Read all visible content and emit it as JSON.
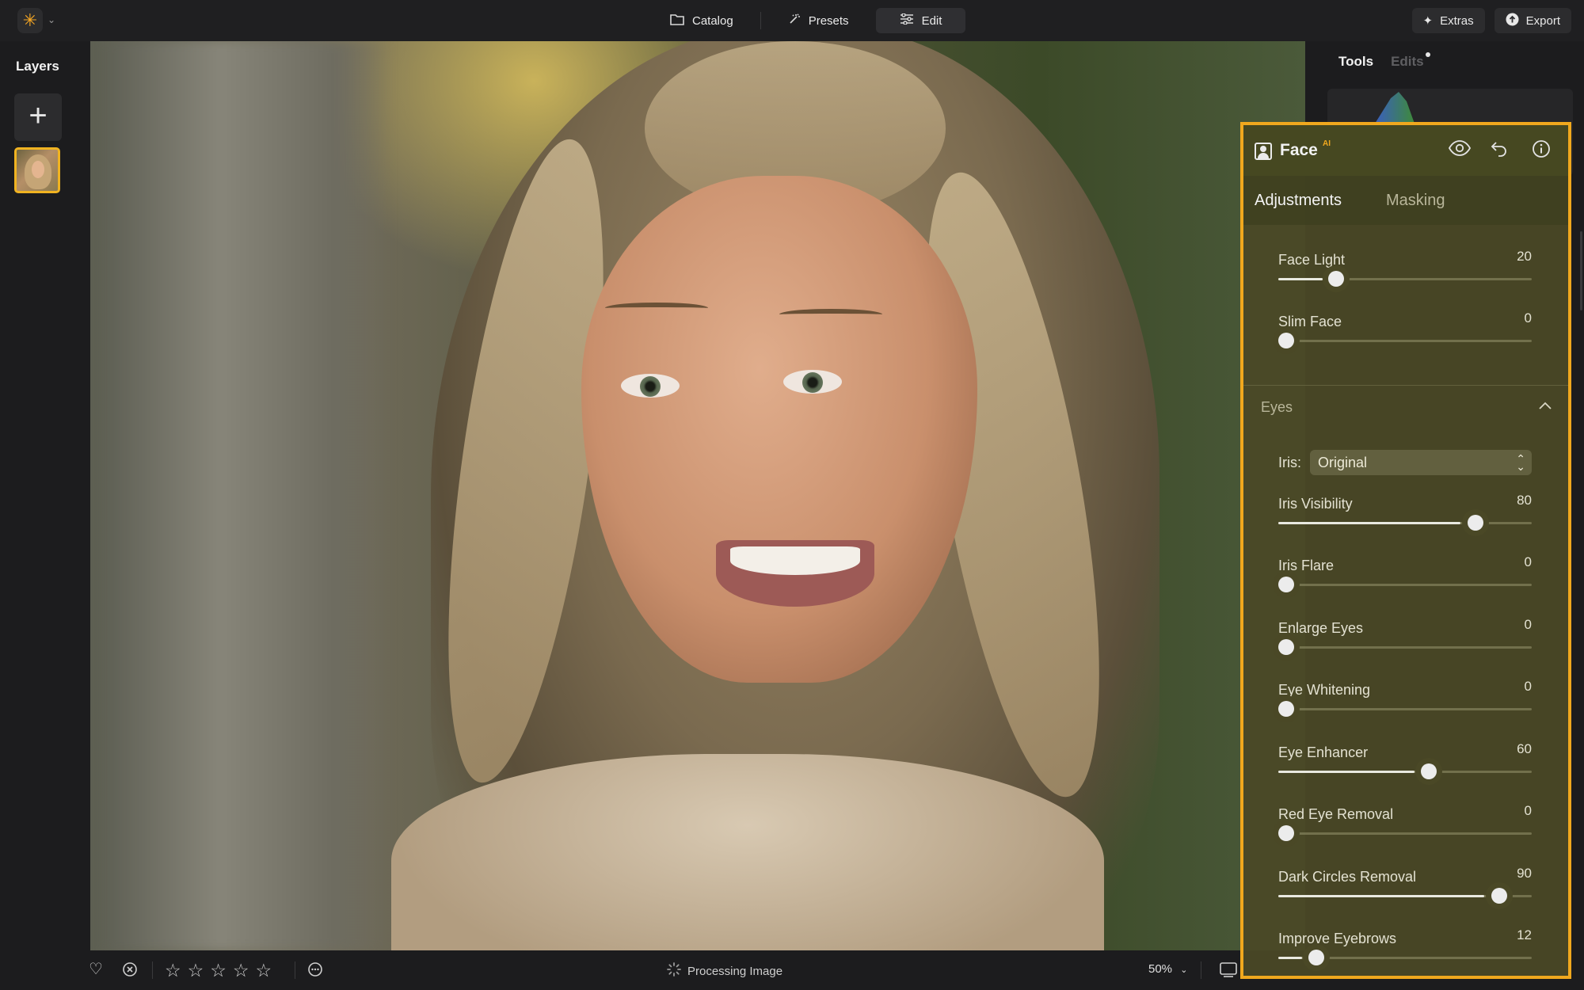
{
  "topbar": {
    "nav": [
      {
        "label": "Catalog",
        "icon": "folder-icon"
      },
      {
        "label": "Presets",
        "icon": "sparkle-wand-icon"
      },
      {
        "label": "Edit",
        "icon": "sliders-icon",
        "active": true
      }
    ],
    "extras_label": "Extras",
    "export_label": "Export"
  },
  "layers": {
    "title": "Layers"
  },
  "tools_panel": {
    "tab_tools": "Tools",
    "tab_edits": "Edits"
  },
  "face_panel": {
    "title": "Face",
    "ai_badge": "AI",
    "tab_adjustments": "Adjustments",
    "tab_masking": "Masking",
    "sliders_top": [
      {
        "label": "Face Light",
        "value": "20"
      },
      {
        "label": "Slim Face",
        "value": "0"
      }
    ],
    "eyes_section": "Eyes",
    "iris_label": "Iris:",
    "iris_value": "Original",
    "sliders_eyes": [
      {
        "label": "Iris Visibility",
        "value": "80"
      },
      {
        "label": "Iris Flare",
        "value": "0"
      },
      {
        "label": "Enlarge Eyes",
        "value": "0"
      },
      {
        "label": "Eye Whitening",
        "value": "0"
      },
      {
        "label": "Eye Enhancer",
        "value": "60"
      },
      {
        "label": "Red Eye Removal",
        "value": "0"
      },
      {
        "label": "Dark Circles Removal",
        "value": "90"
      },
      {
        "label": "Improve Eyebrows",
        "value": "12"
      }
    ]
  },
  "bottombar": {
    "status": "Processing Image",
    "zoom": "50%"
  },
  "colors": {
    "accent": "#f0a81e",
    "panel_bg": "#4a4826"
  }
}
